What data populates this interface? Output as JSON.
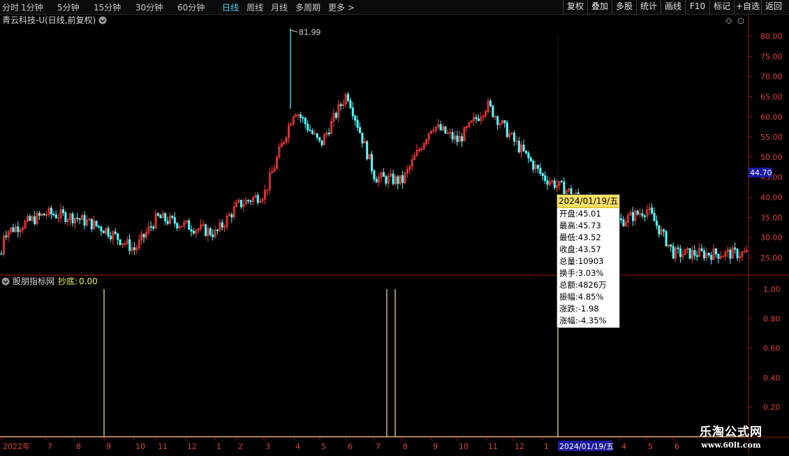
{
  "toolbar": {
    "periods": [
      "分时",
      "1分钟",
      "5分钟",
      "15分钟",
      "30分钟",
      "60分钟",
      "日线",
      "周线",
      "月线",
      "多周期",
      "更多 >"
    ],
    "active_period": "日线",
    "right_buttons": [
      "复权",
      "叠加",
      "多股",
      "统计",
      "画线",
      "F10",
      "标记",
      "+自选",
      "返回"
    ]
  },
  "colors": {
    "up": "#ff3b3b",
    "down": "#54ffff",
    "frame": "#a01818",
    "axis_text": "#e04040",
    "indicator": "#f0f0a0",
    "price_tag_bg": "#1a1aa0"
  },
  "chart": {
    "title": "青云科技-U(日线,前复权)",
    "max_label": "81.99",
    "current_price_tag": "44.70",
    "y_ticks": [
      "80.00",
      "75.00",
      "70.00",
      "65.00",
      "60.00",
      "55.00",
      "50.00",
      "45.00",
      "40.00",
      "35.00",
      "30.00",
      "25.00"
    ]
  },
  "indicator": {
    "name": "股朋指标网",
    "line_label": "抄底:",
    "line_value": "0.00",
    "y_ticks": [
      "1.00",
      "0.80",
      "0.60",
      "0.40",
      "0.20"
    ]
  },
  "x_axis": {
    "labels": [
      "2022年",
      "7",
      "8",
      "9",
      "10",
      "11",
      "12",
      "1",
      "2",
      "3",
      "4",
      "5",
      "6",
      "7",
      "8",
      "9",
      "10",
      "11",
      "12",
      "1",
      "4",
      "5",
      "6"
    ],
    "cursor_date": "2024/01/19/五"
  },
  "tooltip": {
    "date": "2024/01/19/五",
    "rows": [
      "开盘:45.01",
      "最高:45.73",
      "最低:43.52",
      "收盘:43.57",
      "总量:10903",
      "换手:3.03%",
      "总额:4826万",
      "振幅:4.85%",
      "涨跌:-1.98",
      "涨幅:-4.35%"
    ]
  },
  "brand": {
    "name": "乐淘公式网",
    "url": "www.60lt.com"
  },
  "chart_data": {
    "type": "candlestick",
    "title": "青云科技-U(日线,前复权)",
    "ylim": [
      22,
      84
    ],
    "close_path": [
      [
        "2022年",
        31
      ],
      [
        "7",
        36
      ],
      [
        "8",
        35
      ],
      [
        "9",
        32
      ],
      [
        "10",
        27
      ],
      [
        "11",
        35
      ],
      [
        "12",
        33
      ],
      [
        "1",
        31
      ],
      [
        "2",
        38
      ],
      [
        "3",
        41
      ],
      [
        "4",
        62
      ],
      [
        "5",
        53
      ],
      [
        "6",
        66
      ],
      [
        "7",
        45
      ],
      [
        "8",
        44
      ],
      [
        "9",
        58
      ],
      [
        "10",
        54
      ],
      [
        "11",
        63
      ],
      [
        "12",
        54
      ],
      [
        "1",
        45
      ],
      [
        "4",
        34
      ],
      [
        "5",
        37
      ],
      [
        "6",
        26
      ]
    ],
    "max": 81.99,
    "signal_dates": [
      "9",
      "7",
      "8",
      "2024/01/19/五"
    ],
    "signal_value": 1.0
  }
}
